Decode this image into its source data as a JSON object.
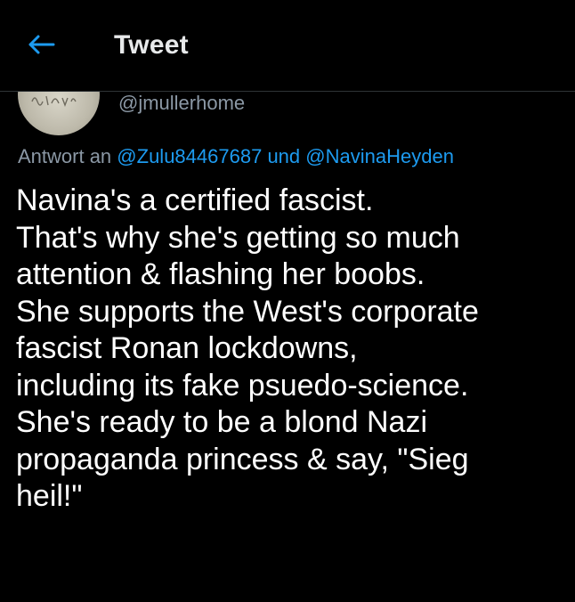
{
  "header": {
    "title": "Tweet"
  },
  "author": {
    "handle": "@jmullerhome"
  },
  "reply_context": {
    "prefix": "Antwort an",
    "mention_1": "@Zulu84467687",
    "conjunction": "und",
    "mention_2": "@NavinaHeyden"
  },
  "tweet": {
    "lines": [
      "Navina's a certified fascist.",
      "That's why she's getting so much",
      "attention & flashing her boobs.",
      "She supports the West's corporate",
      "fascist Ronan lockdowns,",
      "including its fake psuedo-science.",
      "She's ready to be a blond Nazi",
      "propaganda princess & say, \"Sieg",
      "heil!\""
    ]
  },
  "colors": {
    "background": "#000000",
    "accent": "#1d9bf0",
    "secondary_text": "#8b98a5",
    "primary_text": "#ffffff"
  }
}
